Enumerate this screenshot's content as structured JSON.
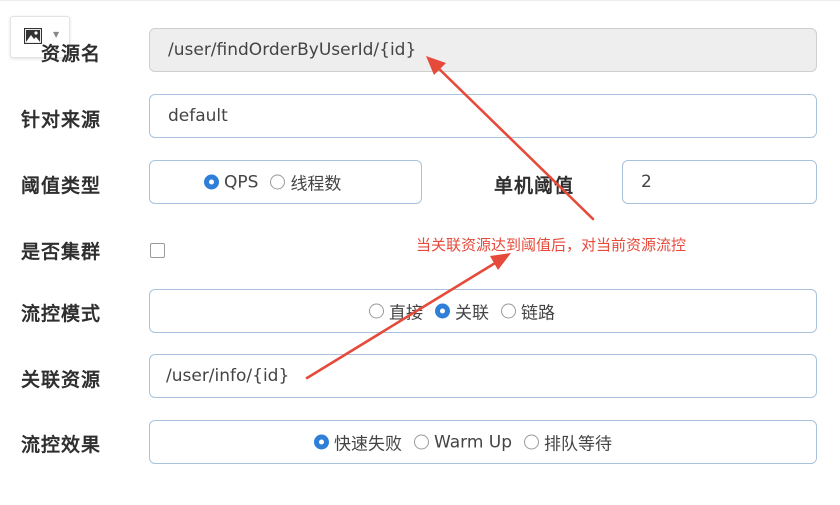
{
  "labels": {
    "resource_name": "资源名",
    "limit_app": "针对来源",
    "grade": "阈值类型",
    "threshold": "单机阈值",
    "cluster": "是否集群",
    "strategy": "流控模式",
    "ref_resource": "关联资源",
    "control_behavior": "流控效果"
  },
  "fields": {
    "resource_name_value": "/user/findOrderByUserId/{id}",
    "limit_app_value": "default",
    "threshold_value": "2",
    "ref_resource_value": "/user/info/{id}"
  },
  "grade_options": [
    {
      "label": "QPS",
      "checked": true
    },
    {
      "label": "线程数",
      "checked": false
    }
  ],
  "strategy_options": [
    {
      "label": "直接",
      "checked": false
    },
    {
      "label": "关联",
      "checked": true
    },
    {
      "label": "链路",
      "checked": false
    }
  ],
  "behavior_options": [
    {
      "label": "快速失败",
      "checked": true
    },
    {
      "label": "Warm Up",
      "checked": false
    },
    {
      "label": "排队等待",
      "checked": false
    }
  ],
  "cluster_checked": false,
  "annotation": {
    "text": "当关联资源达到阈值后，对当前资源流控",
    "color": "#e64a3b"
  },
  "icons": {
    "toolbar": "image-icon",
    "dropdown": "chevron-down-icon"
  },
  "colors": {
    "radio_active": "#2f7ed8",
    "field_border": "#a9c3df"
  }
}
